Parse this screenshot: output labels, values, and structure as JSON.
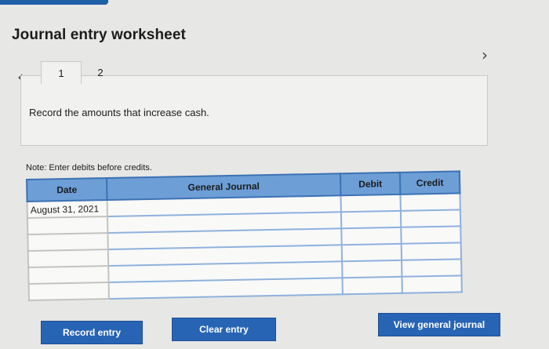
{
  "worksheet": {
    "title": "Journal entry worksheet",
    "prev_icon": "chevron-left-icon",
    "next_icon": "chevron-right-icon",
    "steps": [
      {
        "label": "1",
        "active": true
      },
      {
        "label": "2",
        "active": false
      }
    ],
    "instruction": "Record the amounts that increase cash.",
    "note": "Note: Enter debits before credits."
  },
  "table": {
    "headers": {
      "date": "Date",
      "general_journal": "General Journal",
      "debit": "Debit",
      "credit": "Credit"
    },
    "rows": [
      {
        "date": "August 31, 2021",
        "general_journal": "",
        "debit": "",
        "credit": ""
      },
      {
        "date": "",
        "general_journal": "",
        "debit": "",
        "credit": ""
      },
      {
        "date": "",
        "general_journal": "",
        "debit": "",
        "credit": ""
      },
      {
        "date": "",
        "general_journal": "",
        "debit": "",
        "credit": ""
      },
      {
        "date": "",
        "general_journal": "",
        "debit": "",
        "credit": ""
      },
      {
        "date": "",
        "general_journal": "",
        "debit": "",
        "credit": ""
      }
    ]
  },
  "buttons": {
    "record_entry": "Record entry",
    "clear_entry": "Clear entry",
    "view_general_journal": "View general journal"
  },
  "colors": {
    "accent": "#2864b4",
    "header_fill": "#6d9ed6",
    "header_border": "#3c72b4"
  }
}
